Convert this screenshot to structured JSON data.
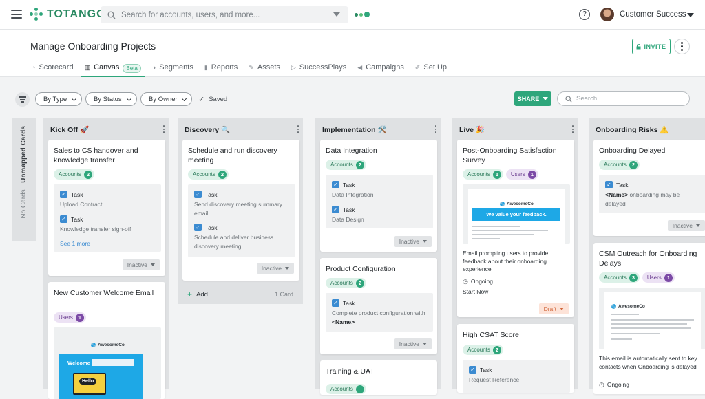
{
  "app": {
    "logo_text": "TOTANGO",
    "search_placeholder": "Search for accounts, users, and more...",
    "user_name": "Customer Success"
  },
  "page": {
    "title": "Manage Onboarding Projects",
    "invite_label": "INVITE"
  },
  "tabs": [
    {
      "label": "Scorecard",
      "icon": "scorecard-icon"
    },
    {
      "label": "Canvas",
      "icon": "canvas-icon",
      "badge": "Beta",
      "active": true
    },
    {
      "label": "Segments",
      "icon": "segments-icon"
    },
    {
      "label": "Reports",
      "icon": "reports-icon"
    },
    {
      "label": "Assets",
      "icon": "assets-icon"
    },
    {
      "label": "SuccessPlays",
      "icon": "play-icon"
    },
    {
      "label": "Campaigns",
      "icon": "megaphone-icon"
    },
    {
      "label": "Set Up",
      "icon": "wrench-icon"
    }
  ],
  "filters": {
    "by_type": "By Type",
    "by_status": "By Status",
    "by_owner": "By Owner",
    "saved": "Saved",
    "share": "SHARE",
    "search_placeholder": "Search"
  },
  "unmapped": {
    "title": "Unmapped Cards",
    "empty": "No Cards"
  },
  "columns": [
    {
      "title": "Kick Off 🚀",
      "cards": [
        {
          "title": "Sales to CS handover and knowledge transfer",
          "accounts_label": "Accounts",
          "accounts": "2",
          "tasks": [
            {
              "label": "Task",
              "desc": "Upload Contract"
            },
            {
              "label": "Task",
              "desc": "Knowledge transfer sign-off"
            }
          ],
          "see_more": "See 1 more",
          "status": "Inactive"
        },
        {
          "title": "New Customer Welcome Email",
          "users_label": "Users",
          "users": "1",
          "preview": {
            "brand": "AwesomeCo",
            "text": "Welcome",
            "bubble": "Hello"
          }
        }
      ]
    },
    {
      "title": "Discovery 🔍",
      "cards": [
        {
          "title": "Schedule and run discovery meeting",
          "accounts_label": "Accounts",
          "accounts": "2",
          "tasks": [
            {
              "label": "Task",
              "desc": "Send discovery meeting summary email"
            },
            {
              "label": "Task",
              "desc": "Schedule and deliver business discovery meeting"
            }
          ],
          "status": "Inactive"
        }
      ],
      "add_label": "Add",
      "count_label": "1 Card"
    },
    {
      "title": "Implementation 🛠️",
      "cards": [
        {
          "title": "Data Integration",
          "accounts_label": "Accounts",
          "accounts": "2",
          "tasks": [
            {
              "label": "Task",
              "desc": "Data Integration"
            },
            {
              "label": "Task",
              "desc": "Data Design"
            }
          ],
          "status": "Inactive"
        },
        {
          "title": "Product Configuration",
          "accounts_label": "Accounts",
          "accounts": "2",
          "tasks": [
            {
              "label": "Task",
              "desc_pre": "Complete product configuration with ",
              "desc_bold": "<Name>"
            }
          ],
          "status": "Inactive"
        },
        {
          "title": "Training & UAT",
          "accounts_label": "Accounts"
        }
      ]
    },
    {
      "title": "Live 🎉",
      "cards": [
        {
          "title": "Post-Onboarding Satisfaction Survey",
          "accounts_label": "Accounts",
          "accounts": "1",
          "users_label": "Users",
          "users": "1",
          "preview": {
            "brand": "AwesomeCo",
            "banner": "We value your feedback."
          },
          "desc": "Email prompting users to provide feedback about their onboarding experience",
          "state": "Ongoing",
          "start": "Start Now",
          "status": "Draft"
        },
        {
          "title": "High CSAT Score",
          "accounts_label": "Accounts",
          "accounts": "2",
          "tasks": [
            {
              "label": "Task",
              "desc": "Request Reference"
            }
          ]
        }
      ]
    },
    {
      "title": "Onboarding Risks ⚠️",
      "cards": [
        {
          "title": "Onboarding Delayed",
          "accounts_label": "Accounts",
          "accounts": "2",
          "tasks": [
            {
              "label": "Task",
              "desc_bold": "<Name>",
              "desc_post": " onboarding may be delayed"
            }
          ],
          "status": "Inactive"
        },
        {
          "title": "CSM Outreach for Onboarding Delays",
          "accounts_label": "Accounts",
          "accounts": "3",
          "users_label": "Users",
          "users": "1",
          "preview": {
            "brand": "AwesomeCo"
          },
          "desc": "This email is automatically sent to key contacts when Onboarding is delayed",
          "state": "Ongoing"
        }
      ]
    }
  ],
  "colors": {
    "accent": "#2ea67b",
    "task_blue": "#3b8bd1",
    "users_purple": "#7c4aa6",
    "draft": "#d0663a"
  }
}
